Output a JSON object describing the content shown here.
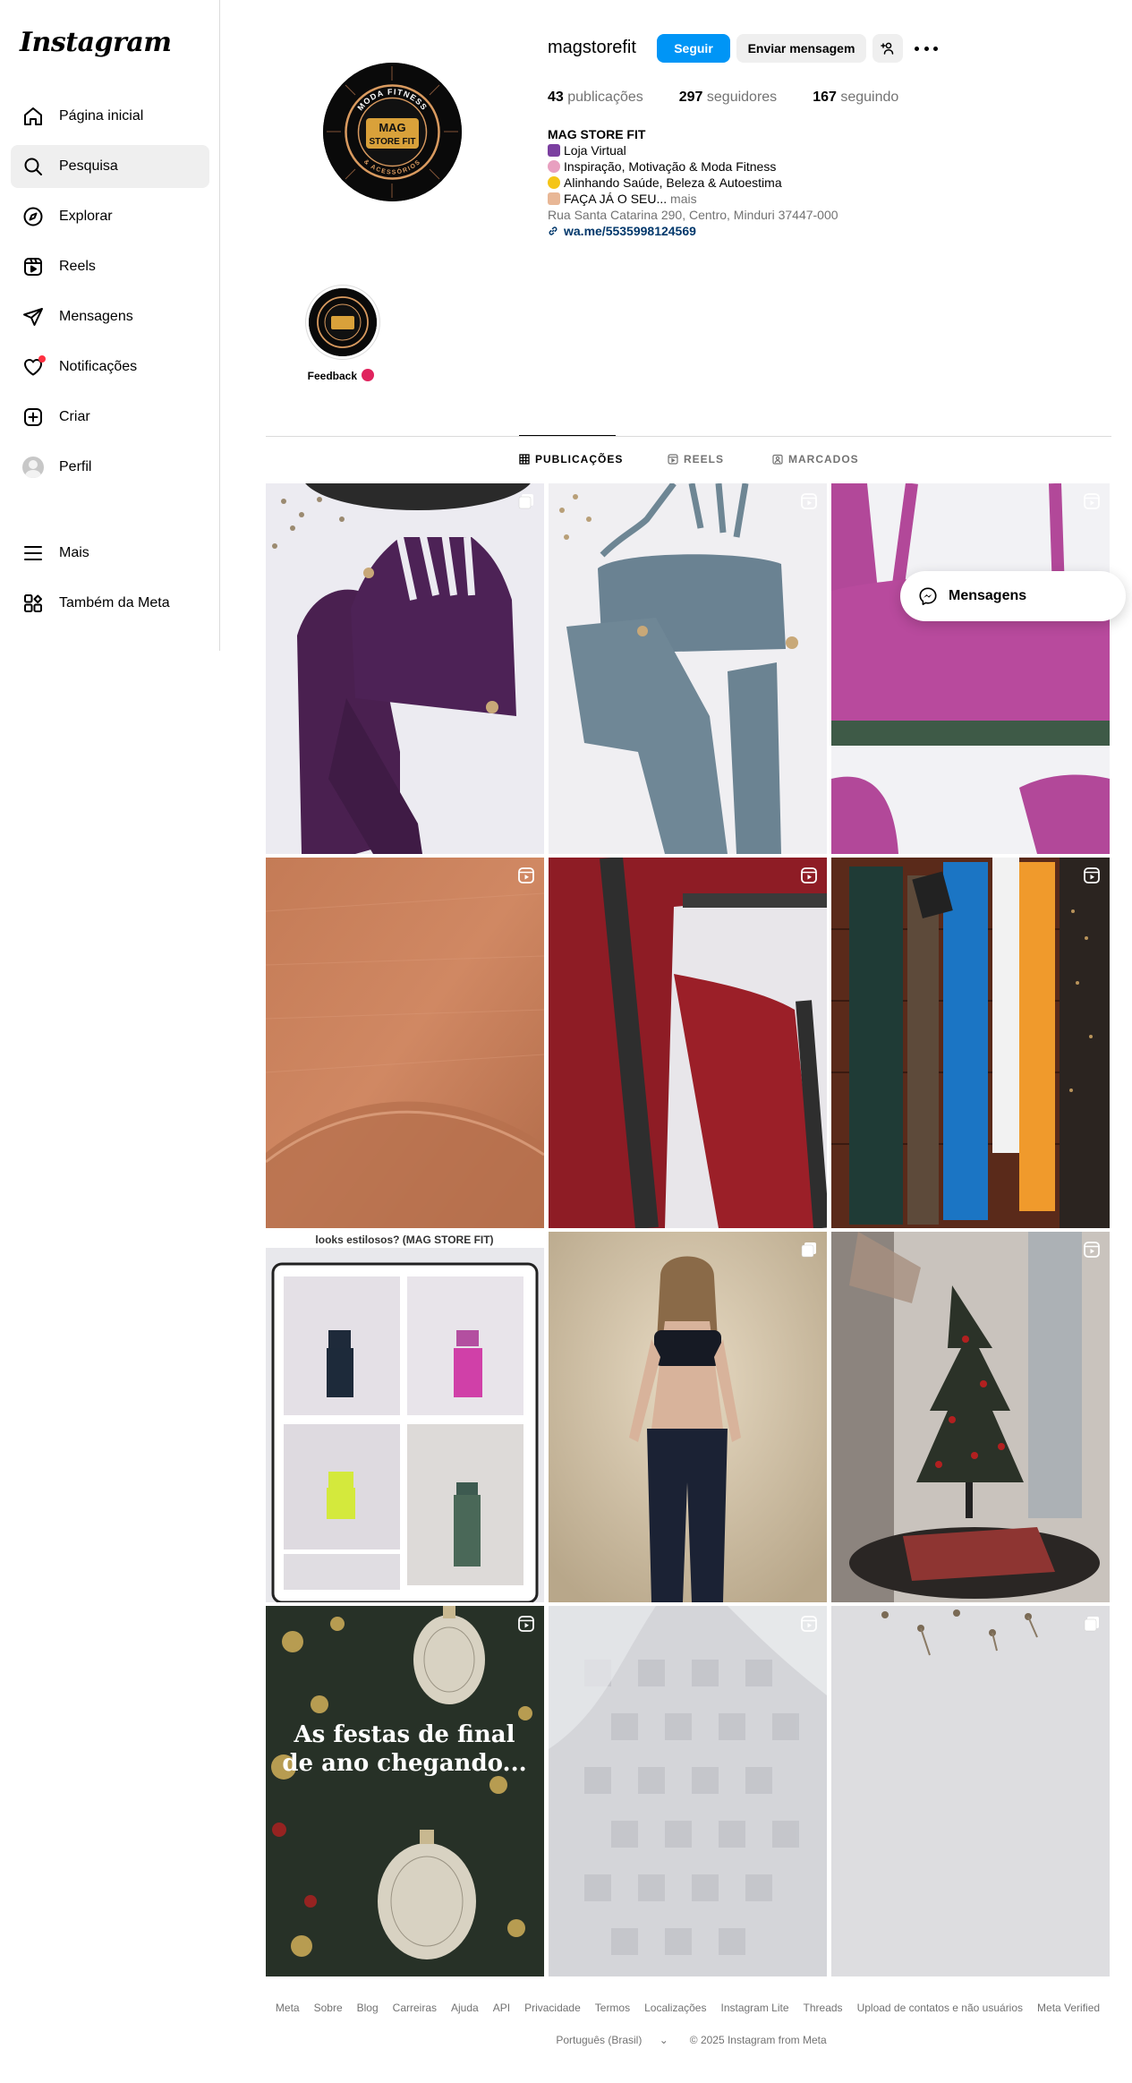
{
  "app": {
    "logo_text": "Instagram"
  },
  "sidebar": {
    "items": [
      {
        "label": "Página inicial",
        "icon": "home-icon"
      },
      {
        "label": "Pesquisa",
        "icon": "search-icon"
      },
      {
        "label": "Explorar",
        "icon": "explore-icon"
      },
      {
        "label": "Reels",
        "icon": "reels-icon"
      },
      {
        "label": "Mensagens",
        "icon": "send-icon"
      },
      {
        "label": "Notificações",
        "icon": "heart-icon"
      },
      {
        "label": "Criar",
        "icon": "plus-square-icon"
      },
      {
        "label": "Perfil",
        "icon": "avatar"
      },
      {
        "label": "Mais",
        "icon": "menu-icon"
      },
      {
        "label": "Também da Meta",
        "icon": "meta-apps-icon"
      }
    ],
    "active_item": "Pesquisa"
  },
  "profile": {
    "username": "magstorefit",
    "follow_label": "Seguir",
    "message_label": "Enviar mensagem",
    "stats": {
      "posts_count": "43",
      "posts_label": "publicações",
      "followers_count": "297",
      "followers_label": "seguidores",
      "following_count": "167",
      "following_label": "seguindo"
    },
    "bio": {
      "name": "MAG STORE FIT",
      "lines": [
        "Loja Virtual",
        "Inspiração, Motivação & Moda Fitness",
        "Alinhando Saúde, Beleza & Autoestima",
        "FAÇA JÁ O SEU..."
      ],
      "more": "mais",
      "address": "Rua Santa Catarina 290, Centro, Minduri 37447-000",
      "link": "wa.me/5535998124569"
    },
    "logo_text": {
      "top": "MODA FITNESS",
      "main1": "MAG",
      "main2": "STORE FIT",
      "bottom": "& ACESSÓRIOS"
    }
  },
  "highlights": [
    {
      "label": "Feedback"
    }
  ],
  "tabs": [
    {
      "label": "PUBLICAÇÕES",
      "icon": "grid-icon",
      "active": true
    },
    {
      "label": "REELS",
      "icon": "reels-icon",
      "active": false
    },
    {
      "label": "MARCADOS",
      "icon": "tagged-icon",
      "active": false
    }
  ],
  "posts": [
    {
      "type": "carousel",
      "description": "purple set"
    },
    {
      "type": "reel",
      "description": "blue set"
    },
    {
      "type": "reel",
      "description": "pink set"
    },
    {
      "type": "reel",
      "description": "orange fabric"
    },
    {
      "type": "reel",
      "description": "red legging"
    },
    {
      "type": "reel",
      "description": "clothes rack"
    },
    {
      "type": "none",
      "description": "looks collage",
      "overlay_text": "looks estilosos? (MAG STORE FIT)"
    },
    {
      "type": "carousel",
      "description": "model"
    },
    {
      "type": "reel",
      "description": "christmas tree"
    },
    {
      "type": "reel",
      "description": "christmas ornaments",
      "overlay_text": "As festas de final de ano chegando..."
    },
    {
      "type": "reel",
      "description": "white fabric"
    },
    {
      "type": "carousel",
      "description": "white fabric 2"
    }
  ],
  "floating_messages": {
    "label": "Mensagens"
  },
  "footer": {
    "links": [
      "Meta",
      "Sobre",
      "Blog",
      "Carreiras",
      "Ajuda",
      "API",
      "Privacidade",
      "Termos",
      "Localizações",
      "Instagram Lite",
      "Threads",
      "Upload de contatos e não usuários",
      "Meta Verified"
    ],
    "language": "Português (Brasil)",
    "copyright": "© 2025 Instagram from Meta"
  },
  "colors": {
    "primary": "#0095f6",
    "link": "#00376b",
    "muted": "#737373",
    "notification": "#ff3040"
  }
}
